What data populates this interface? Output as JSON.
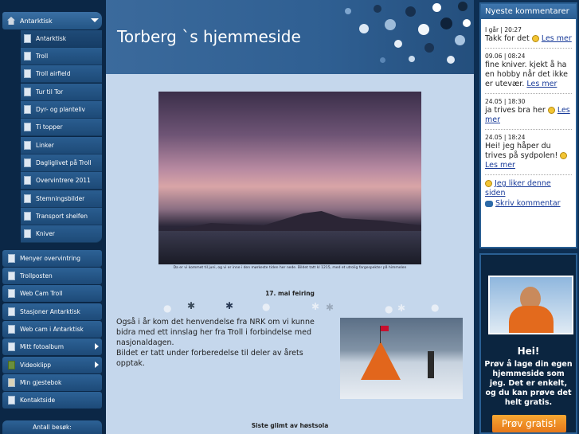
{
  "header": {
    "site_title": "Torberg `s hjemmeside"
  },
  "nav": {
    "antarktisk": "Antarktisk",
    "sub_items": [
      "Antarktisk",
      "Troll",
      "Troll airfield",
      "Tur til Tor",
      "Dyr- og planteliv",
      "Ti topper",
      "Linker",
      "Dagliglivet på Troll",
      "Overvintrere 2011",
      "Stemningsbilder",
      "Transport shelfen",
      "Kniver"
    ],
    "main_items": [
      "Menyer overvintring",
      "Trollposten",
      "Web Cam Troll",
      "Stasjoner Antarktisk",
      "Web cam i Antarktisk",
      "Mitt fotoalbum",
      "Videoklipp",
      "Min gjestebok",
      "Kontaktside"
    ],
    "visits_label": "Antall besøk:"
  },
  "content": {
    "photo_caption": "Da er vi kommet til juni, og vi er inne i den mørkeste tiden her nede. Bildet tatt kl 1215, med et utrolig fargespekter på himmelen",
    "section1_title": "17. mai feiring",
    "para1": "Også i år kom det henvendelse fra NRK om vi kunne bidra med ett innslag her fra Troll i forbindelse med nasjonaldagen.",
    "para2": "Bildet er tatt under forberedelse til deler av årets opptak.",
    "section2_title": "Siste glimt av høstsola"
  },
  "comments": {
    "title": "Nyeste kommentarer",
    "items": [
      {
        "date": "I går | 20:27",
        "text": "Takk for det",
        "link": "Les mer"
      },
      {
        "date": "09.06 | 08:24",
        "text": "fine kniver. kjekt å ha en hobby når det ikke er utevær.",
        "link": "Les mer"
      },
      {
        "date": "24.05 | 18:30",
        "text": "ja trives bra her",
        "link": "Les mer"
      },
      {
        "date": "24.05 | 18:24",
        "text": "Hei! jeg håper du trives på sydpolen!",
        "link": "Les mer"
      }
    ],
    "like_label": "Jeg liker denne siden",
    "write_label": "Skriv kommentar"
  },
  "promo": {
    "hei": "Hei!",
    "text": "Prøv å lage din egen hjemmeside som jeg. Det er enkelt, og du kan prøve det helt gratis.",
    "button": "Prøv gratis!"
  },
  "colors": {
    "header": "#2f5f92",
    "content_bg": "#c5d7ec",
    "sidebar": "#0b2746",
    "promo_button": "#f0902a"
  }
}
